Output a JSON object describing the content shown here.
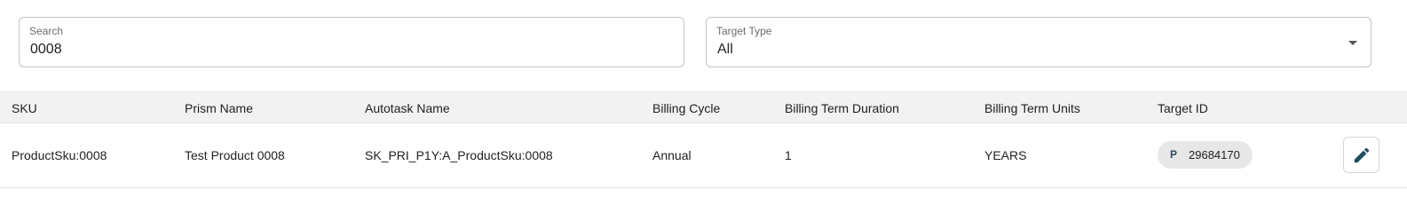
{
  "filters": {
    "search": {
      "label": "Search",
      "value": "0008"
    },
    "target_type": {
      "label": "Target Type",
      "value": "All"
    }
  },
  "table": {
    "columns": [
      "SKU",
      "Prism Name",
      "Autotask Name",
      "Billing Cycle",
      "Billing Term Duration",
      "Billing Term Units",
      "Target ID"
    ],
    "rows": [
      {
        "sku": "ProductSku:0008",
        "prism_name": "Test Product 0008",
        "autotask_name": "SK_PRI_P1Y:A_ProductSku:0008",
        "billing_cycle": "Annual",
        "billing_term_duration": "1",
        "billing_term_units": "YEARS",
        "target_id": {
          "prefix": "P",
          "id": "29684170"
        },
        "action_icon": "pencil-icon"
      }
    ]
  },
  "colors": {
    "header_bg": "#f2f2f2",
    "chip_bg": "#e7e7e7",
    "icon_color": "#1f4e5f"
  }
}
